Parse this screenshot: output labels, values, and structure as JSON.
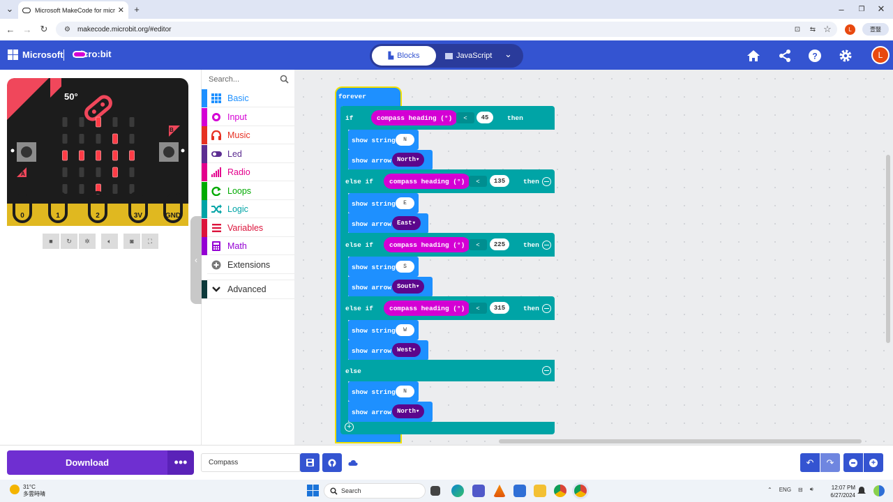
{
  "browser": {
    "tab_title": "Microsoft MakeCode for micro:b",
    "url": "makecode.microbit.org/#editor",
    "profile_initial": "L",
    "extension_label": "壹豎"
  },
  "header": {
    "brand": "Microsoft",
    "product": "micro:bit",
    "blocks_label": "Blocks",
    "javascript_label": "JavaScript",
    "avatar_initial": "L"
  },
  "simulator": {
    "heading_readout": "50°",
    "pins": [
      "0",
      "1",
      "2",
      "3V",
      "GND"
    ],
    "button_a": "A",
    "button_b": "B",
    "led_matrix": [
      [
        0,
        0,
        1,
        0,
        0
      ],
      [
        0,
        0,
        0,
        1,
        0
      ],
      [
        1,
        1,
        1,
        1,
        1
      ],
      [
        0,
        0,
        0,
        1,
        0
      ],
      [
        0,
        0,
        1,
        0,
        0
      ]
    ]
  },
  "toolbox": {
    "search_placeholder": "Search...",
    "categories": [
      {
        "label": "Basic",
        "color": "#1e90ff"
      },
      {
        "label": "Input",
        "color": "#d400d4"
      },
      {
        "label": "Music",
        "color": "#e63022"
      },
      {
        "label": "Led",
        "color": "#5c2d91"
      },
      {
        "label": "Radio",
        "color": "#e3008c"
      },
      {
        "label": "Loops",
        "color": "#00aa00"
      },
      {
        "label": "Logic",
        "color": "#00a4a6"
      },
      {
        "label": "Variables",
        "color": "#dc143c"
      },
      {
        "label": "Math",
        "color": "#9400d3"
      },
      {
        "label": "Extensions",
        "color": "#777777"
      },
      {
        "label": "Advanced",
        "color": "#222222"
      }
    ]
  },
  "code": {
    "forever": "forever",
    "if_kw": "if",
    "else_if_kw": "else if",
    "else_kw": "else",
    "then_kw": "then",
    "show_string": "show string",
    "show_arrow": "show arrow",
    "compass": "compass heading (°)",
    "operator": "<",
    "branches": [
      {
        "threshold": "45",
        "string": "N",
        "arrow": "North"
      },
      {
        "threshold": "135",
        "string": "E",
        "arrow": "East"
      },
      {
        "threshold": "225",
        "string": "S",
        "arrow": "South"
      },
      {
        "threshold": "315",
        "string": "W",
        "arrow": "West"
      }
    ],
    "else_branch": {
      "string": "N",
      "arrow": "North"
    }
  },
  "footer": {
    "download_label": "Download",
    "more_label": "•••",
    "project_name": "Compass"
  },
  "taskbar": {
    "temperature": "31°C",
    "weather_desc": "多雲時晴",
    "search_label": "Search",
    "language": "ENG",
    "time": "12:07 PM",
    "date": "6/27/2024"
  }
}
